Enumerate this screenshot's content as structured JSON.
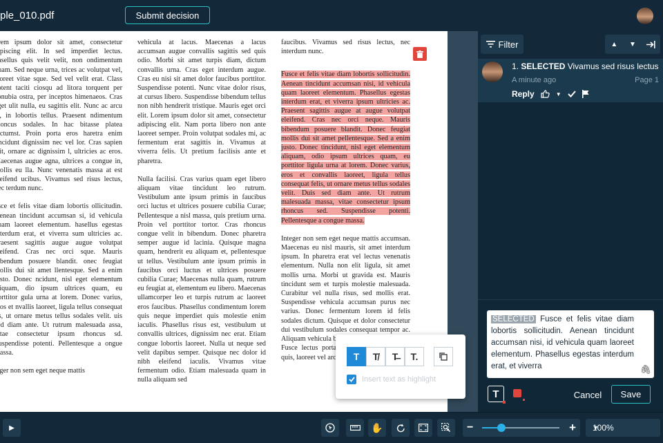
{
  "header": {
    "filename": "ple_010.pdf",
    "submit_label": "Submit decision"
  },
  "document": {
    "col1": [
      "orem ipsum dolor sit amet, consectetur dipiscing elit. In sed imperdiet lectus. hasellus quis velit velit, non ondimentum quam. Sed neque urna, trices ac volutpat vel, laoreet vitae sque. Sed vel velit erat. Class aptent taciti ciosqu ad litora torquent per conubia ostra, per inceptos himenaeos. Cras eget ulit nulla, eu sagittis elit. Nunc ac arcu el, in lobortis tellus. Praesent ndimentum rhoncus sodales. In hac bitasse platea dictumst. Proin porta eros haretra enim tincidunt dignissim nec vel lor. Cras sapien elit, ornare ac dignissim l, ultricies ac eros. Maecenas augue agna, ultrices a congue in, mollis eu lla. Nunc venenatis massa at est eleifend ucibus. Vivamus sed risus lectus, nec terdum nunc.",
      "usce et felis vitae diam lobortis ollicitudin. Aenean tincidunt accumsan si, id vehicula quam laoreet elementum. hasellus egestas interdum erat, et viverra sum ultricies ac. Praesent sagittis augue augue volutpat eleifend. Cras nec orci sque. Mauris bibendum posuere blandit. onec feugiat mollis dui sit amet llentesque. Sed a enim justo. Donec ncidunt, nisl eget elementum aliquam, dio ipsum ultrices quam, eu porttitor gula urna at lorem. Donec varius, eros et nvallis laoreet, ligula tellus consequat lis, ut ornare metus tellus sodales velit. uis sed diam ante. Ut rutrum malesuada assa, vitae consectetur ipsum rhoncus sd. Suspendisse potenti. Pellentesque a ongue massa.",
      "teger non sem eget neque mattis"
    ],
    "col2": [
      "vehicula at lacus. Maecenas a lacus accumsan augue convallis sagittis sed quis odio. Morbi sit amet turpis diam, dictum convallis urna. Cras eget interdum augue. Cras eu nisi sit amet dolor faucibus porttitor. Suspendisse potenti. Nunc vitae dolor risus, at cursus libero. Suspendisse bibendum tellus non nibh hendrerit tristique. Mauris eget orci elit. Lorem ipsum dolor sit amet, consectetur adipiscing elit. Nam porta libero non ante laoreet semper. Proin volutpat sodales mi, ac fermentum erat sagittis in. Vivamus at viverra felis. Ut pretium facilisis ante et pharetra.",
      "Nulla facilisi. Cras varius quam eget libero aliquam vitae tincidunt leo rutrum. Vestibulum ante ipsum primis in faucibus orci luctus et ultrices posuere cubilia Curae; Pellentesque a nisl massa, quis pretium urna. Proin vel porttitor tortor. Cras rhoncus congue velit in bibendum. Donec pharetra semper augue id lacinia. Quisque magna quam, hendrerit eu aliquam et, pellentesque ut tellus. Vestibulum ante ipsum primis in faucibus orci luctus et ultrices posuere cubilia Curae; Maecenas nulla quam, rutrum eu feugiat at, elementum eu libero. Maecenas ullamcorper leo et turpis rutrum ac laoreet eros faucibus. Phasellus condimentum lorem quis neque imperdiet quis molestie enim iaculis. Phasellus risus est, vestibulum ut convallis ultrices, dignissim nec erat. Etiam congue lobortis laoreet. Nulla ut neque sed velit dapibus semper. Quisque nec dolor id nibh eleifend iaculis. Vivamus vitae fermentum odio. Etiam malesuada quam in nulla aliquam sed"
    ],
    "col3_intro": "faucibus. Vivamus sed risus lectus, nec interdum nunc.",
    "col3_highlight": "Fusce et felis vitae diam lobortis sollicitudin. Aenean tincidunt accumsan nisi, id vehicula quam laoreet elementum. Phasellus egestas interdum erat, et viverra ipsum ultricies ac. Praesent sagittis augue at augue volutpat eleifend. Cras nec orci neque. Mauris bibendum posuere blandit. Donec feugiat mollis dui sit amet pellentesque. Sed a enim justo. Donec tincidunt, nisl eget elementum aliquam, odio ipsum ultrices quam, eu porttitor ligula urna at lorem. Donec varius, eros et convallis laoreet, ligula tellus consequat felis, ut ornare metus tellus sodales velit. Duis sed diam ante. Ut rutrum malesuada massa, vitae consectetur ipsum rhoncus sed. Suspendisse potenti. Pellentesque a congue massa.",
    "col3_after": "Integer non sem eget neque mattis accumsan. Maecenas eu nisl mauris, sit amet interdum ipsum. In pharetra erat vel lectus venenatis elementum. Nulla non elit ligula, sit amet mollis urna. Morbi ut gravida est. Mauris tincidunt sem et turpis molestie malesuada. Curabitur vel nulla risus, sed mollis erat. Suspendisse vehicula accumsan purus nec varius. Donec fermentum lorem id felis sodales dictum. Quisque et dolor consectetur dui vestibulum sodales consequat tempor ac. Aliquam vehicula bibendum congue tristique. Fusce lectus porta sed sagittis id pharetra quis, laoreet vel arcu.",
    "highlight_color": "#f3a3a0"
  },
  "float_tool": {
    "buttons": [
      "T",
      "T̸",
      "T̶",
      "T."
    ],
    "copy_icon": "copy-icon",
    "checkbox_label": "Insert text as highlight",
    "checked": true
  },
  "panel": {
    "filter_label": "Filter",
    "comment": {
      "index": "1.",
      "tag": "SELECTED",
      "title": "Vivamus sed risus lectus",
      "time": "A minute ago",
      "page": "Page 1",
      "reply_label": "Reply"
    },
    "editor": {
      "tag": "SELECTED",
      "text": "Fusce et felis vitae diam lobortis sollicitudin. Aenean tincidunt accumsan nisi, id vehicula quam laoreet elementum. Phasellus egestas interdum erat, et viverra",
      "cancel_label": "Cancel",
      "save_label": "Save"
    }
  },
  "bottom": {
    "zoom_value": "100%",
    "zoom_level": 0.25,
    "accent": "#2bb0e8"
  }
}
